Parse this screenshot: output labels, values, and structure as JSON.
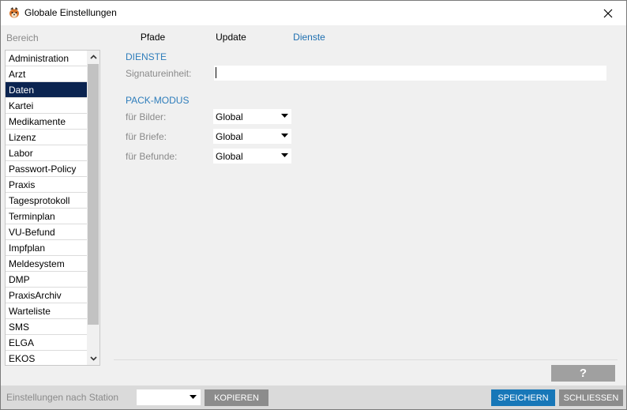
{
  "window": {
    "title": "Globale Einstellungen",
    "app_icon": "app-logo-icon",
    "close_icon": "close-icon"
  },
  "sidebar": {
    "label": "Bereich",
    "selected": "Daten",
    "items": [
      "Administration",
      "Arzt",
      "Daten",
      "Kartei",
      "Medikamente",
      "Lizenz",
      "Labor",
      "Passwort-Policy",
      "Praxis",
      "Tagesprotokoll",
      "Terminplan",
      "VU-Befund",
      "Impfplan",
      "Meldesystem",
      "DMP",
      "PraxisArchiv",
      "Warteliste",
      "SMS",
      "ELGA",
      "EKOS"
    ]
  },
  "tabs": [
    {
      "label": "Pfade"
    },
    {
      "label": "Update"
    },
    {
      "label": "Dienste"
    }
  ],
  "active_tab": "Dienste",
  "dienste": {
    "section_title": "DIENSTE",
    "signatur_label": "Signatureinheit:",
    "signatur_value": ""
  },
  "pack_modus": {
    "section_title": "PACK-MODUS",
    "bilder_label": "für Bilder:",
    "bilder_value": "Global",
    "briefe_label": "für Briefe:",
    "briefe_value": "Global",
    "befunde_label": "für Befunde:",
    "befunde_value": "Global"
  },
  "help_button": "?",
  "bottom": {
    "station_label": "Einstellungen nach Station",
    "station_value": "",
    "kopieren": "KOPIEREN",
    "speichern": "SPEICHERN",
    "schliessen": "SCHLIESSEN"
  },
  "colors": {
    "accent": "#1e6fb0",
    "section_title": "#2e7dbb",
    "selected_item": "#0b2450",
    "primary_button": "#1777b8",
    "secondary_button": "#8c8c8c"
  }
}
